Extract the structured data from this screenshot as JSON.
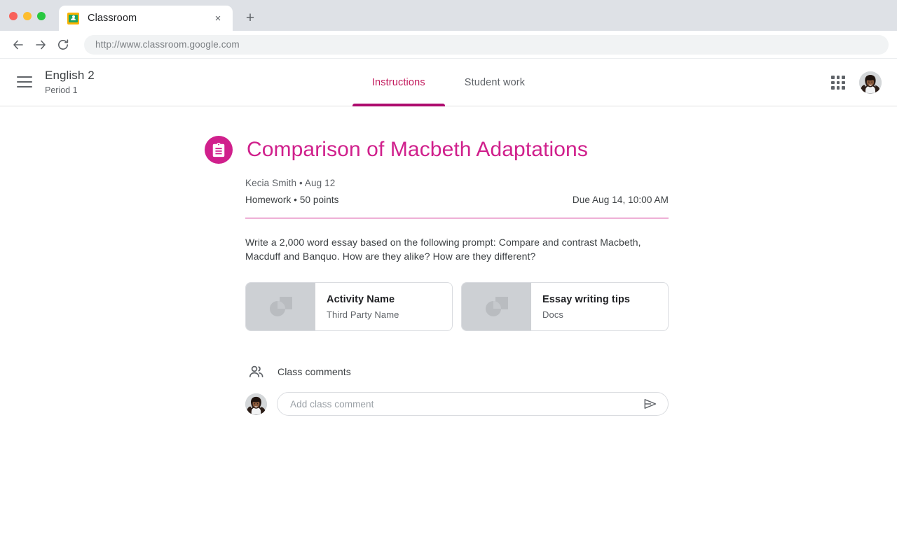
{
  "browser": {
    "tab": {
      "title": "Classroom",
      "favicon": "google-classroom-icon",
      "close_label": "×"
    },
    "new_tab_label": "+",
    "toolbar": {
      "back_icon": "arrow-left-icon",
      "forward_icon": "arrow-right-icon",
      "reload_icon": "reload-icon",
      "url": "http://www.classroom.google.com"
    },
    "window_controls": {
      "close": "close-window",
      "minimize": "minimize-window",
      "maximize": "maximize-window"
    }
  },
  "app_header": {
    "menu_icon": "hamburger-menu-icon",
    "course_name": "English 2",
    "course_section": "Period 1",
    "tabs": [
      {
        "label": "Instructions",
        "active": true
      },
      {
        "label": "Student work",
        "active": false
      }
    ],
    "apps_icon": "apps-grid-icon",
    "avatar": "user-avatar"
  },
  "assignment": {
    "icon": "assignment-clipboard-icon",
    "title": "Comparison of Macbeth Adaptations",
    "author": "Kecia Smith",
    "posted_separator": "•",
    "posted_date": "Aug 12",
    "author_line": "Kecia Smith  • Aug 12",
    "category_line": "Homework • 50 points",
    "category": "Homework",
    "points": "50 points",
    "due": "Due Aug 14, 10:00 AM",
    "description": "Write a 2,000 word essay based on the following prompt: Compare and contrast Macbeth, Macduff and Banquo. How are they alike? How are they different?"
  },
  "attachments": [
    {
      "name": "Activity Name",
      "subtitle": "Third Party Name",
      "thumb_icon": "generic-file-thumbnail"
    },
    {
      "name": "Essay writing tips",
      "subtitle": "Docs",
      "thumb_icon": "generic-file-thumbnail"
    }
  ],
  "comments": {
    "icon": "people-icon",
    "heading": "Class comments",
    "avatar": "current-user-avatar",
    "input_value": "",
    "input_placeholder": "Add class comment",
    "send_icon": "send-icon"
  },
  "colors": {
    "accent_magenta": "#d0208c",
    "tab_underline": "#ad0b6e",
    "tab_active_text": "#c2185b",
    "text_primary": "#3c4043",
    "text_secondary": "#5f6368",
    "chrome_bg": "#dee1e6",
    "omnibox_bg": "#f1f3f4",
    "card_border": "#dadce0",
    "thumb_bg": "#cdd0d4"
  }
}
